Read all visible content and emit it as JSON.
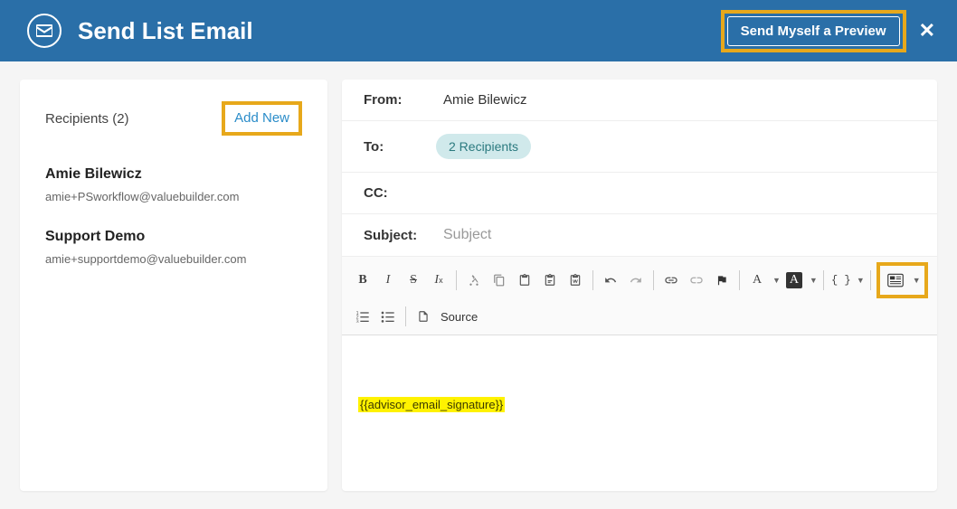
{
  "header": {
    "title": "Send List Email",
    "preview_button": "Send Myself a Preview"
  },
  "recipients_panel": {
    "label": "Recipients (2)",
    "add_new": "Add New",
    "list": [
      {
        "name": "Amie Bilewicz",
        "email": "amie+PSworkflow@valuebuilder.com"
      },
      {
        "name": "Support Demo",
        "email": "amie+supportdemo@valuebuilder.com"
      }
    ]
  },
  "compose": {
    "from_label": "From:",
    "from_value": "Amie Bilewicz",
    "to_label": "To:",
    "to_pill": "2 Recipients",
    "cc_label": "CC:",
    "subject_label": "Subject:",
    "subject_placeholder": "Subject"
  },
  "toolbar": {
    "bold": "B",
    "italic": "I",
    "strike": "S",
    "clear_format": "Iₓ",
    "text_color": "A",
    "bg_color": "A",
    "braces": "{ }",
    "source": "Source"
  },
  "editor": {
    "signature_token": "{{advisor_email_signature}}"
  }
}
